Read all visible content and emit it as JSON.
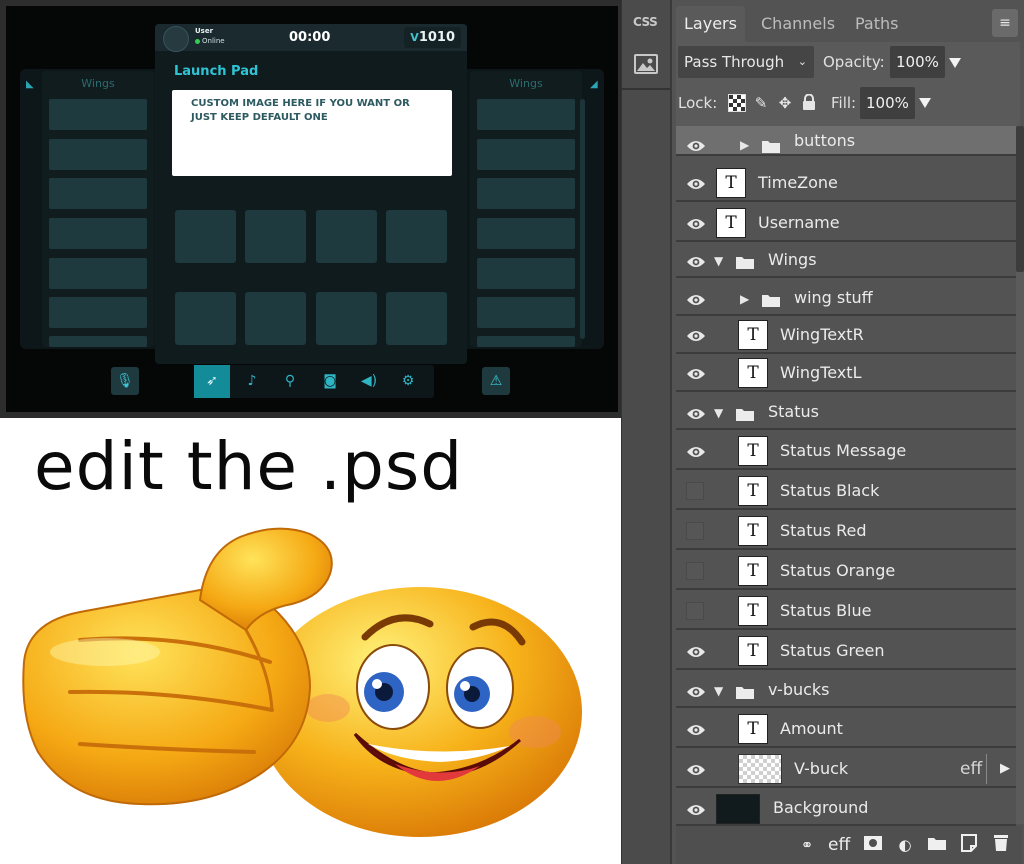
{
  "mockup": {
    "user": {
      "name": "User",
      "status": "Online"
    },
    "clock": "00:00",
    "currency_symbol": "V",
    "currency_amount": "1010",
    "launch_pad_title": "Launch Pad",
    "custom_image_text": "CUSTOM IMAGE HERE IF YOU WANT OR JUST KEEP DEFAULT ONE",
    "wing_left_title": "Wings",
    "wing_right_title": "Wings",
    "dock_icons": [
      "microphone-icon",
      "rocket-icon",
      "bell-icon",
      "map-pin-icon",
      "camera-icon",
      "volume-icon",
      "gear-icon",
      "warning-icon"
    ],
    "accent_color": "#2fc4d5"
  },
  "caption": "edit the .psd",
  "emoji": {
    "description_icon": "thumbs-up-smiley-icon"
  },
  "toolbar": {
    "css_label": "CSS",
    "image_icon": "image-icon"
  },
  "panel": {
    "tabs": [
      "Layers",
      "Channels",
      "Paths"
    ],
    "active_tab": "Layers",
    "menu_icon": "hamburger-icon",
    "blend_mode": "Pass Through",
    "opacity_label": "Opacity:",
    "opacity_value": "100%",
    "lock_label": "Lock:",
    "fill_label": "Fill:",
    "fill_value": "100%",
    "layers": [
      {
        "name": "buttons",
        "kind": "folder",
        "expanded": false,
        "visible": true,
        "selected": true,
        "indent": 1
      },
      {
        "name": "TimeZone",
        "kind": "text",
        "visible": true,
        "indent": 0
      },
      {
        "name": "Username",
        "kind": "text",
        "visible": true,
        "indent": 0
      },
      {
        "name": "Wings",
        "kind": "folder",
        "expanded": true,
        "visible": true,
        "indent": 0
      },
      {
        "name": "wing stuff",
        "kind": "folder",
        "expanded": false,
        "visible": true,
        "indent": 1
      },
      {
        "name": "WingTextR",
        "kind": "text",
        "visible": true,
        "indent": 1
      },
      {
        "name": "WingTextL",
        "kind": "text",
        "visible": true,
        "indent": 1
      },
      {
        "name": "Status",
        "kind": "folder",
        "expanded": true,
        "visible": true,
        "indent": 0
      },
      {
        "name": "Status Message",
        "kind": "text",
        "visible": true,
        "indent": 1
      },
      {
        "name": "Status Black",
        "kind": "text",
        "visible": false,
        "indent": 1
      },
      {
        "name": "Status Red",
        "kind": "text",
        "visible": false,
        "indent": 1
      },
      {
        "name": "Status Orange",
        "kind": "text",
        "visible": false,
        "indent": 1
      },
      {
        "name": "Status Blue",
        "kind": "text",
        "visible": false,
        "indent": 1
      },
      {
        "name": "Status Green",
        "kind": "text",
        "visible": true,
        "indent": 1
      },
      {
        "name": "v-bucks",
        "kind": "folder",
        "expanded": true,
        "visible": true,
        "indent": 0
      },
      {
        "name": "Amount",
        "kind": "text",
        "visible": true,
        "indent": 1
      },
      {
        "name": "V-buck",
        "kind": "image",
        "visible": true,
        "indent": 1,
        "effect": "eff"
      },
      {
        "name": "Background",
        "kind": "background",
        "visible": true,
        "indent": 0
      }
    ],
    "footer_icons": [
      "link-icon",
      "effects-icon",
      "mask-icon",
      "adjustment-icon",
      "new-folder-icon",
      "new-layer-icon",
      "trash-icon"
    ],
    "footer_eff_label": "eff"
  }
}
